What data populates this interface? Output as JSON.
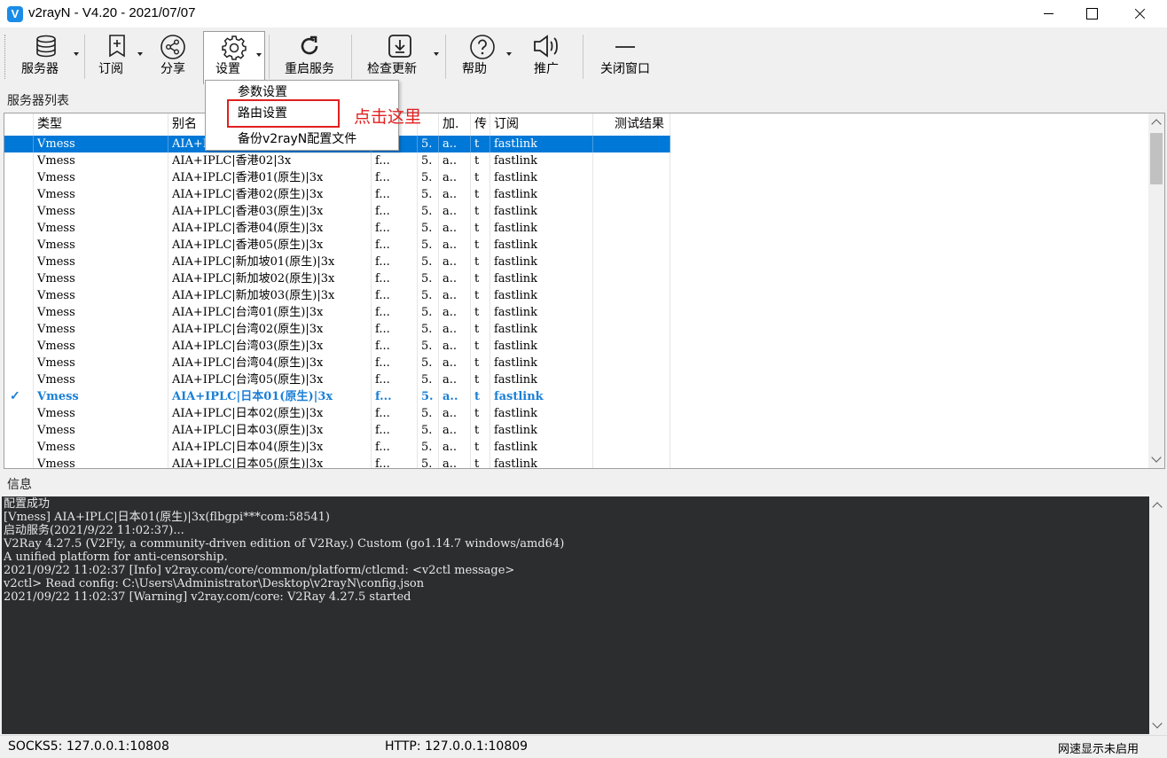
{
  "window": {
    "title": "v2rayN - V4.20 - 2021/07/07",
    "icon": "v2rayn-logo-icon"
  },
  "toolbar": {
    "servers": "服务器",
    "subscription": "订阅",
    "share": "分享",
    "settings": "设置",
    "restart": "重启服务",
    "check_update": "检查更新",
    "help": "帮助",
    "promote": "推广",
    "close_window": "关闭窗口"
  },
  "settings_menu": {
    "items": [
      "参数设置",
      "路由设置",
      "备份v2rayN配置文件"
    ]
  },
  "annotation": {
    "callout": "点击这里",
    "highlight_color": "#e02020"
  },
  "server_list": {
    "label": "服务器列表",
    "columns": [
      "类型",
      "别名",
      "",
      "",
      "加.",
      "传",
      "订阅",
      "测试结果"
    ],
    "rows": [
      {
        "type": "Vmess",
        "alias": "AIA+IPLC|",
        "addr": "f...",
        "port": "5.",
        "enc": "a..",
        "net": "t",
        "sub": "fastlink",
        "test": ""
      },
      {
        "type": "Vmess",
        "alias": "AIA+IPLC|香港02|3x",
        "addr": "f...",
        "port": "5.",
        "enc": "a..",
        "net": "t",
        "sub": "fastlink",
        "test": ""
      },
      {
        "type": "Vmess",
        "alias": "AIA+IPLC|香港01(原生)|3x",
        "addr": "f...",
        "port": "5.",
        "enc": "a..",
        "net": "t",
        "sub": "fastlink",
        "test": ""
      },
      {
        "type": "Vmess",
        "alias": "AIA+IPLC|香港02(原生)|3x",
        "addr": "f...",
        "port": "5.",
        "enc": "a..",
        "net": "t",
        "sub": "fastlink",
        "test": ""
      },
      {
        "type": "Vmess",
        "alias": "AIA+IPLC|香港03(原生)|3x",
        "addr": "f...",
        "port": "5.",
        "enc": "a..",
        "net": "t",
        "sub": "fastlink",
        "test": ""
      },
      {
        "type": "Vmess",
        "alias": "AIA+IPLC|香港04(原生)|3x",
        "addr": "f...",
        "port": "5.",
        "enc": "a..",
        "net": "t",
        "sub": "fastlink",
        "test": ""
      },
      {
        "type": "Vmess",
        "alias": "AIA+IPLC|香港05(原生)|3x",
        "addr": "f...",
        "port": "5.",
        "enc": "a..",
        "net": "t",
        "sub": "fastlink",
        "test": ""
      },
      {
        "type": "Vmess",
        "alias": "AIA+IPLC|新加坡01(原生)|3x",
        "addr": "f...",
        "port": "5.",
        "enc": "a..",
        "net": "t",
        "sub": "fastlink",
        "test": ""
      },
      {
        "type": "Vmess",
        "alias": "AIA+IPLC|新加坡02(原生)|3x",
        "addr": "f...",
        "port": "5.",
        "enc": "a..",
        "net": "t",
        "sub": "fastlink",
        "test": ""
      },
      {
        "type": "Vmess",
        "alias": "AIA+IPLC|新加坡03(原生)|3x",
        "addr": "f...",
        "port": "5.",
        "enc": "a..",
        "net": "t",
        "sub": "fastlink",
        "test": ""
      },
      {
        "type": "Vmess",
        "alias": "AIA+IPLC|台湾01(原生)|3x",
        "addr": "f...",
        "port": "5.",
        "enc": "a..",
        "net": "t",
        "sub": "fastlink",
        "test": ""
      },
      {
        "type": "Vmess",
        "alias": "AIA+IPLC|台湾02(原生)|3x",
        "addr": "f...",
        "port": "5.",
        "enc": "a..",
        "net": "t",
        "sub": "fastlink",
        "test": ""
      },
      {
        "type": "Vmess",
        "alias": "AIA+IPLC|台湾03(原生)|3x",
        "addr": "f...",
        "port": "5.",
        "enc": "a..",
        "net": "t",
        "sub": "fastlink",
        "test": ""
      },
      {
        "type": "Vmess",
        "alias": "AIA+IPLC|台湾04(原生)|3x",
        "addr": "f...",
        "port": "5.",
        "enc": "a..",
        "net": "t",
        "sub": "fastlink",
        "test": ""
      },
      {
        "type": "Vmess",
        "alias": "AIA+IPLC|台湾05(原生)|3x",
        "addr": "f...",
        "port": "5.",
        "enc": "a..",
        "net": "t",
        "sub": "fastlink",
        "test": ""
      },
      {
        "type": "Vmess",
        "alias": "AIA+IPLC|日本01(原生)|3x",
        "addr": "f...",
        "port": "5.",
        "enc": "a..",
        "net": "t",
        "sub": "fastlink",
        "test": "",
        "active": true
      },
      {
        "type": "Vmess",
        "alias": "AIA+IPLC|日本02(原生)|3x",
        "addr": "f...",
        "port": "5.",
        "enc": "a..",
        "net": "t",
        "sub": "fastlink",
        "test": ""
      },
      {
        "type": "Vmess",
        "alias": "AIA+IPLC|日本03(原生)|3x",
        "addr": "f...",
        "port": "5.",
        "enc": "a..",
        "net": "t",
        "sub": "fastlink",
        "test": ""
      },
      {
        "type": "Vmess",
        "alias": "AIA+IPLC|日本04(原生)|3x",
        "addr": "f...",
        "port": "5.",
        "enc": "a..",
        "net": "t",
        "sub": "fastlink",
        "test": ""
      },
      {
        "type": "Vmess",
        "alias": "AIA+IPLC|日本05(原生)|3x",
        "addr": "f...",
        "port": "5.",
        "enc": "a..",
        "net": "t",
        "sub": "fastlink",
        "test": ""
      }
    ],
    "selected_index": 0,
    "active_mark": "✓"
  },
  "log": {
    "label": "信息",
    "lines": [
      "配置成功",
      "[Vmess] AIA+IPLC|日本01(原生)|3x(flbgpi***com:58541)",
      "启动服务(2021/9/22 11:02:37)...",
      "V2Ray 4.27.5 (V2Fly, a community-driven edition of V2Ray.) Custom (go1.14.7 windows/amd64)",
      "A unified platform for anti-censorship.",
      "2021/09/22 11:02:37 [Info] v2ray.com/core/common/platform/ctlcmd: <v2ctl message>",
      "v2ctl> Read config:  C:\\Users\\Administrator\\Desktop\\v2rayN\\config.json",
      "2021/09/22 11:02:37 [Warning] v2ray.com/core: V2Ray 4.27.5 started"
    ]
  },
  "status": {
    "socks": "SOCKS5:  127.0.0.1:10808",
    "http": "HTTP:  127.0.0.1:10809",
    "speed": "网速显示未启用"
  }
}
